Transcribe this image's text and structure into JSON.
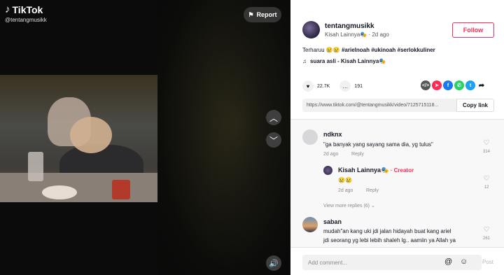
{
  "video": {
    "logo_text": "TikTok",
    "handle": "@tentangmusikk",
    "report_label": "Report",
    "prev_icon": "chevron-up-icon",
    "next_icon": "chevron-down-icon",
    "sound_icon": "speaker-icon"
  },
  "author": {
    "name": "tentangmusikk",
    "subtitle": "Kisah Lainnya🎭 · 2d ago",
    "follow_label": "Follow"
  },
  "caption": {
    "text": "Terharuu 😢😢",
    "hashtags": "#arielnoah #ukinoah #serlokkuliner"
  },
  "music": {
    "label": "suara asli - Kisah Lainnya🎭"
  },
  "stats": {
    "likes": "22.7K",
    "comments": "191"
  },
  "share_icons": [
    "embed-icon",
    "send-icon",
    "facebook-icon",
    "whatsapp-icon",
    "twitter-icon",
    "share-arrow-icon"
  ],
  "link": {
    "url": "https://www.tiktok.com/@tentangmusikk/video/7125715118...",
    "copy_label": "Copy link"
  },
  "comments": [
    {
      "user": "ndknx",
      "text": "\"ga banyak yang sayang sama dia, yg tulus\"",
      "time": "2d ago",
      "reply_label": "Reply",
      "likes": "314"
    },
    {
      "user": "Kisah Lainnya🎭",
      "badge": "· Creator",
      "text": "😢😢",
      "time": "2d ago",
      "reply_label": "Reply",
      "likes": "12"
    },
    {
      "user": "saban",
      "text_line1": "mudah\"an kang uki jdi jalan hidayah buat kang ariel",
      "text_line2": "jdi seorang yg lebi lebih shaleh lg.. aamiin ya Allah ya",
      "likes": "261"
    }
  ],
  "view_more": "View more replies (6)",
  "comment_input": {
    "placeholder": "Add comment...",
    "post_label": "Post"
  }
}
